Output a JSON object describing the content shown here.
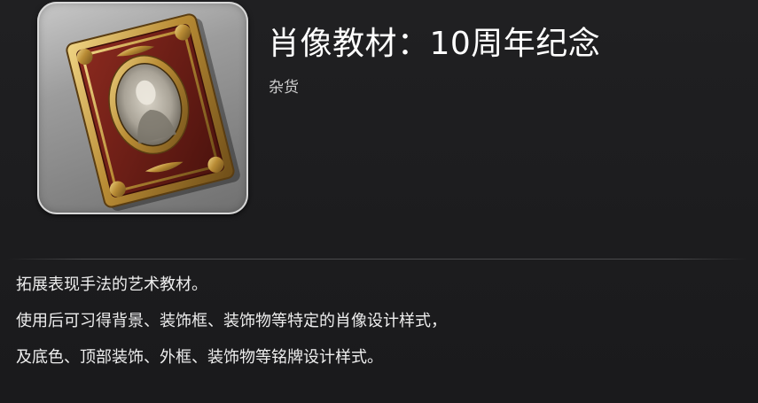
{
  "item": {
    "name": "肖像教材：10周年纪念",
    "category": "杂货",
    "icon": "portrait-book-icon",
    "description_lines": [
      "拓展表现手法的艺术教材。",
      "使用后可习得背景、装饰框、装饰物等特定的肖像设计样式，",
      "及底色、顶部装饰、外框、装饰物等铭牌设计样式。"
    ]
  },
  "colors": {
    "background": "#1d1d1f",
    "title": "#ffffff",
    "category": "#cfcfcf",
    "text": "#eeeeee",
    "icon_gold": "#c9a24a",
    "icon_crimson": "#6b1c16"
  }
}
